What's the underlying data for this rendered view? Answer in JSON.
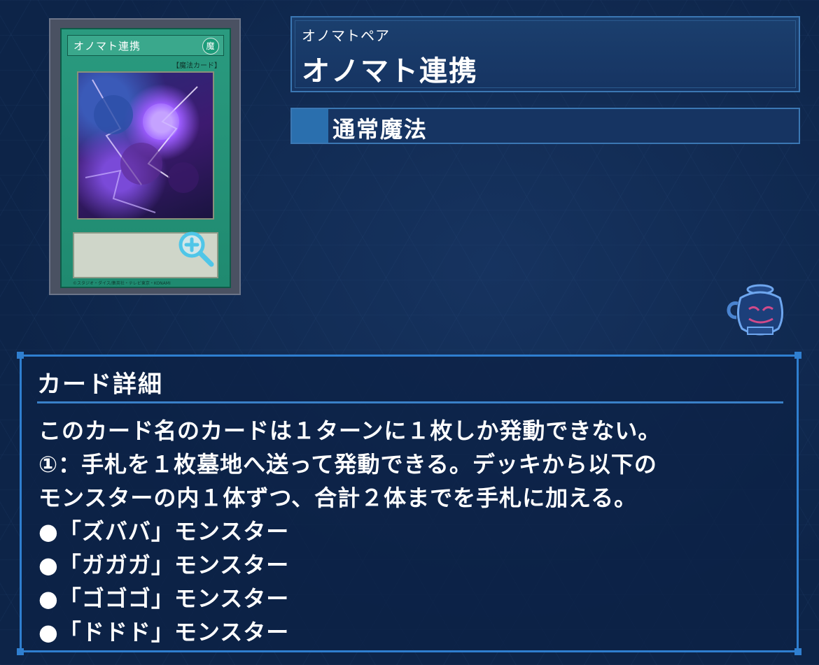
{
  "card": {
    "name_on_card": "オノマト連携",
    "attribute_glyph": "魔",
    "type_line": "【魔法カード】",
    "zoom_icon": "magnifier-plus-icon",
    "footer": "©スタジオ・ダイス/集英社・テレビ東京・KONAMI"
  },
  "name_panel": {
    "reading": "オノマトペア",
    "title": "オノマト連携"
  },
  "type_bar": {
    "label": "通常魔法"
  },
  "pot_icon": "pot-of-greed-icon",
  "details": {
    "header": "カード詳細",
    "lines": [
      "このカード名のカードは１ターンに１枚しか発動できない。",
      "①：手札を１枚墓地へ送って発動できる。デッキから以下の",
      "モンスターの内１体ずつ、合計２体までを手札に加える。",
      "●「ズババ」モンスター",
      "●「ガガガ」モンスター",
      "●「ゴゴゴ」モンスター",
      "●「ドドド」モンスター"
    ]
  },
  "colors": {
    "background": "#0d2448",
    "panel_border": "#3b77b3",
    "detail_border": "#2f7fd0",
    "spell_card_green": "#1f8a70"
  }
}
